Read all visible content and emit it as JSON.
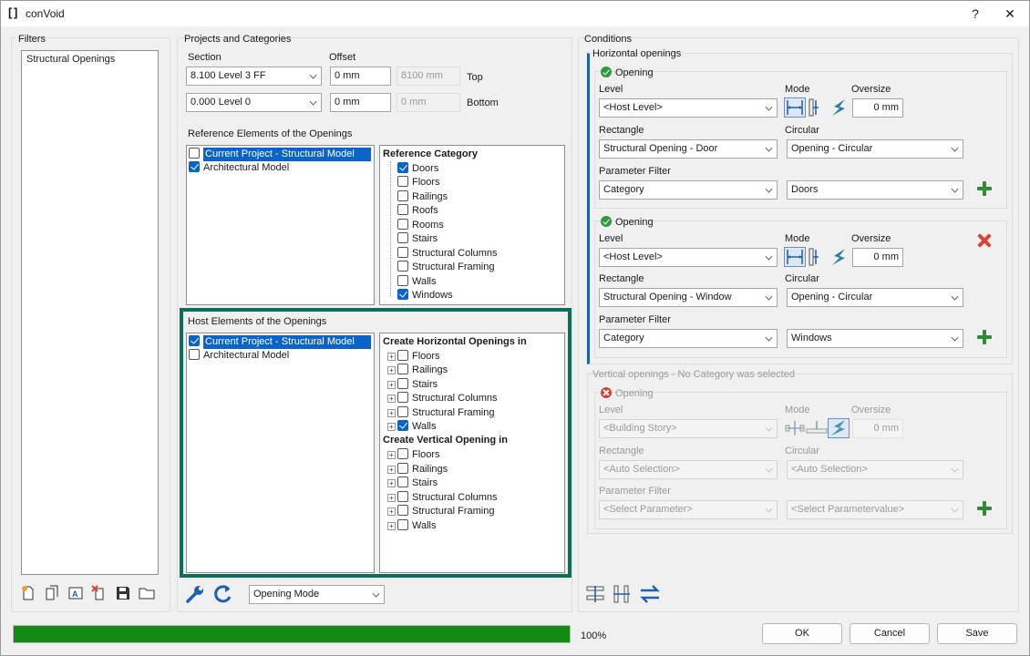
{
  "window": {
    "title": "conVoid",
    "help_label": "?",
    "close_label": "✕"
  },
  "filters": {
    "label": "Filters",
    "items": [
      "Structural Openings"
    ]
  },
  "projects": {
    "label": "Projects and Categories",
    "section_label": "Section",
    "offset_label": "Offset",
    "top_section": "8.100  Level 3 FF",
    "top_offset": "0 mm",
    "top_value": "8100 mm",
    "top_label": "Top",
    "bottom_section": "0.000  Level 0",
    "bottom_offset": "0 mm",
    "bottom_value": "0 mm",
    "bottom_label": "Bottom",
    "reference_label": "Reference Elements of the Openings",
    "reference_models": [
      {
        "label": "Current Project - Structural Model",
        "checked": false,
        "selected": true
      },
      {
        "label": "Architectural Model",
        "checked": true,
        "selected": false
      }
    ],
    "reference_category_head": "Reference Category",
    "reference_categories": [
      {
        "label": "Doors",
        "checked": true
      },
      {
        "label": "Floors",
        "checked": false
      },
      {
        "label": "Railings",
        "checked": false
      },
      {
        "label": "Roofs",
        "checked": false
      },
      {
        "label": "Rooms",
        "checked": false
      },
      {
        "label": "Stairs",
        "checked": false
      },
      {
        "label": "Structural Columns",
        "checked": false
      },
      {
        "label": "Structural Framing",
        "checked": false
      },
      {
        "label": "Walls",
        "checked": false
      },
      {
        "label": "Windows",
        "checked": true
      }
    ],
    "host_label": "Host Elements of the Openings",
    "host_models": [
      {
        "label": "Current Project - Structural Model",
        "checked": true,
        "selected": true
      },
      {
        "label": "Architectural Model",
        "checked": false,
        "selected": false
      }
    ],
    "horizontal_head": "Create Horizontal Openings in",
    "horizontal_items": [
      {
        "label": "Floors",
        "checked": false
      },
      {
        "label": "Railings",
        "checked": false
      },
      {
        "label": "Stairs",
        "checked": false
      },
      {
        "label": "Structural Columns",
        "checked": false
      },
      {
        "label": "Structural Framing",
        "checked": false
      },
      {
        "label": "Walls",
        "checked": true
      }
    ],
    "vertical_head": "Create Vertical Opening in",
    "vertical_items": [
      {
        "label": "Floors",
        "checked": false
      },
      {
        "label": "Railings",
        "checked": false
      },
      {
        "label": "Stairs",
        "checked": false
      },
      {
        "label": "Structural Columns",
        "checked": false
      },
      {
        "label": "Structural Framing",
        "checked": false
      },
      {
        "label": "Walls",
        "checked": false
      }
    ],
    "mode_select": "Opening Mode"
  },
  "conditions": {
    "label": "Conditions",
    "horizontal_label": "Horizontal openings",
    "openings": [
      {
        "title": "Opening",
        "level_label": "Level",
        "mode_label": "Mode",
        "oversize_label": "Oversize",
        "level": "<Host Level>",
        "oversize": "0 mm",
        "rect_label": "Rectangle",
        "circ_label": "Circular",
        "rect": "Structural Opening - Door",
        "circ": "Opening - Circular",
        "filter_label": "Parameter Filter",
        "filter_param": "Category",
        "filter_value": "Doors"
      },
      {
        "title": "Opening",
        "level_label": "Level",
        "mode_label": "Mode",
        "oversize_label": "Oversize",
        "level": "<Host Level>",
        "oversize": "0 mm",
        "rect_label": "Rectangle",
        "circ_label": "Circular",
        "rect": "Structural Opening - Window",
        "circ": "Opening - Circular",
        "filter_label": "Parameter Filter",
        "filter_param": "Category",
        "filter_value": "Windows"
      }
    ],
    "vertical_label": "Vertical openings - No Category was selected",
    "vertical": {
      "title": "Opening",
      "level_label": "Level",
      "mode_label": "Mode",
      "oversize_label": "Oversize",
      "level": "<Building Story>",
      "oversize": "0 mm",
      "rect_label": "Rectangle",
      "circ_label": "Circular",
      "rect": "<Auto Selection>",
      "circ": "<Auto Selection>",
      "filter_label": "Parameter Filter",
      "filter_param": "<Select Parameter>",
      "filter_value": "<Select Parametervalue>"
    }
  },
  "footer": {
    "progress": 100,
    "progress_text": "100%",
    "ok": "OK",
    "cancel": "Cancel",
    "save": "Save"
  },
  "colors": {
    "accent": "#0a64c8",
    "progress": "#138a13",
    "highlight_border": "#0b6e5a",
    "plus": "#2f8a3a",
    "remove": "#d9413a"
  }
}
